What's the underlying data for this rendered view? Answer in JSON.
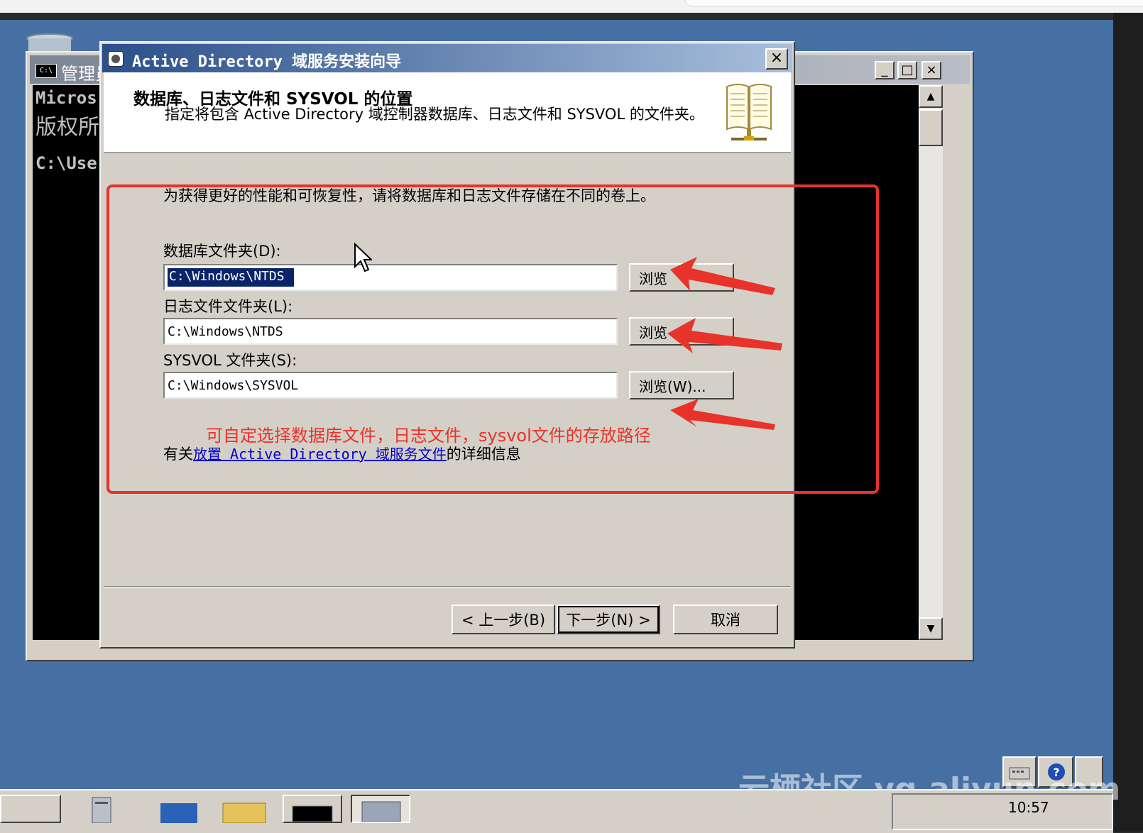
{
  "console": {
    "title": "管理员",
    "lines": [
      "Micros",
      "版权所",
      "",
      "C:\\Use"
    ],
    "minimize": "_",
    "maximize": "□",
    "close": "×"
  },
  "wizard": {
    "title": "Active Directory 域服务安装向导",
    "close": "×",
    "heading": "数据库、日志文件和 SYSVOL 的位置",
    "subheading": "指定将包含 Active Directory 域控制器数据库、日志文件和 SYSVOL 的文件夹。",
    "intro": "为获得更好的性能和可恢复性，请将数据库和日志文件存储在不同的卷上。",
    "database": {
      "label": "数据库文件夹(D):",
      "value": "C:\\Windows\\NTDS",
      "browse": "浏览"
    },
    "log": {
      "label": "日志文件文件夹(L):",
      "value": "C:\\Windows\\NTDS",
      "browse": "浏览"
    },
    "sysvol": {
      "label": "SYSVOL 文件夹(S):",
      "value": "C:\\Windows\\SYSVOL",
      "browse": "浏览(W)..."
    },
    "more_prefix": "有关",
    "more_link": "放置 Active Directory 域服务文件",
    "more_suffix": "的详细信息",
    "back": "< 上一步(B)",
    "next": "下一步(N) >",
    "cancel": "取消"
  },
  "annotation": {
    "text": "可自定选择数据库文件，日志文件，sysvol文件的存放路径",
    "color": "#e8332a"
  },
  "taskbar": {
    "clock": "10:57"
  },
  "watermark": "云栖社区 yq.aliyun.com"
}
